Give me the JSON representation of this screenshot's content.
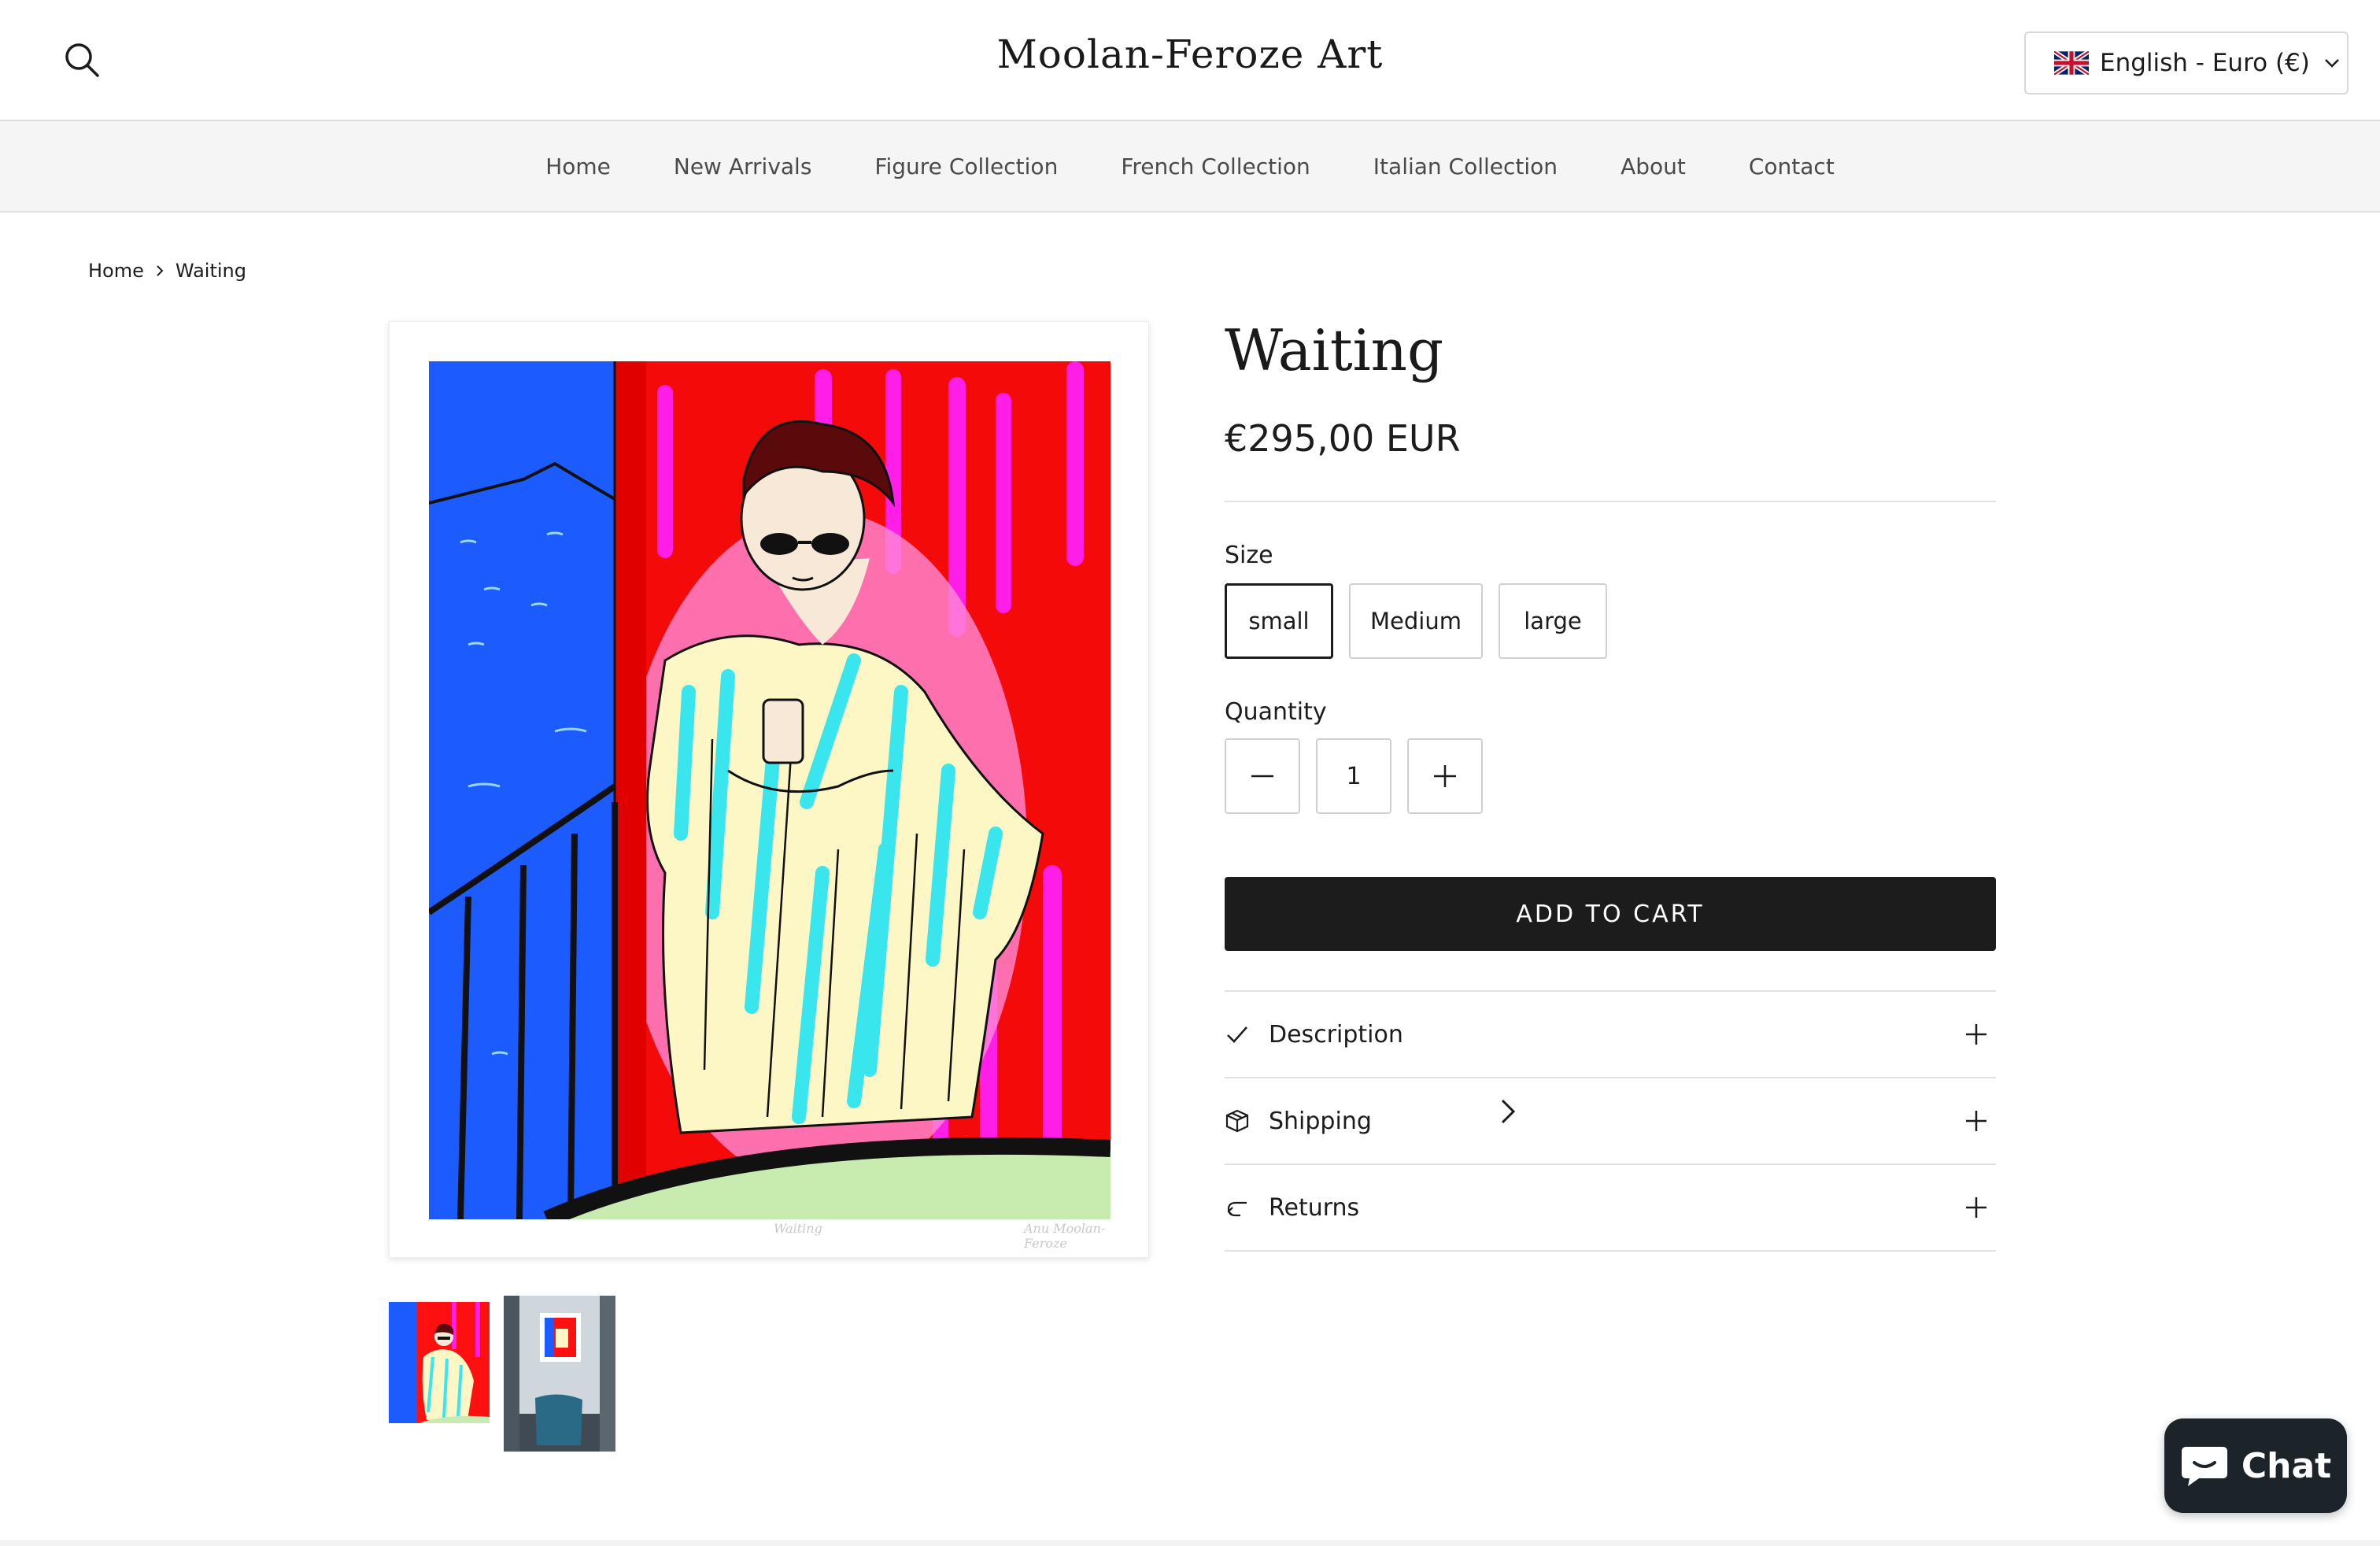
{
  "header": {
    "logo": "Moolan-Feroze Art",
    "locale_label": "English - Euro (€)",
    "icons": {
      "search": "search-icon",
      "flag": "uk-flag-icon",
      "dropdown": "chevron-down-icon"
    }
  },
  "nav": {
    "items": [
      {
        "label": "Home"
      },
      {
        "label": "New Arrivals"
      },
      {
        "label": "Figure Collection"
      },
      {
        "label": "French Collection"
      },
      {
        "label": "Italian Collection"
      },
      {
        "label": "About"
      },
      {
        "label": "Contact"
      }
    ]
  },
  "breadcrumb": {
    "home": "Home",
    "current": "Waiting"
  },
  "gallery": {
    "main_alt": "Waiting artwork: woman in striped shirt with sunglasses looking at phone on balcony",
    "signature_left": "Waiting",
    "signature_right": "Anu Moolan-Feroze",
    "thumbnail_count": 2
  },
  "product": {
    "title": "Waiting",
    "price": "€295,00 EUR",
    "size_label": "Size",
    "sizes": [
      "small",
      "Medium",
      "large"
    ],
    "selected_size": "small",
    "quantity_label": "Quantity",
    "quantity": "1",
    "add_to_cart": "ADD TO CART",
    "accordion": [
      {
        "label": "Description",
        "icon": "check-icon"
      },
      {
        "label": "Shipping",
        "icon": "box-icon"
      },
      {
        "label": "Returns",
        "icon": "return-arrow-icon"
      }
    ]
  },
  "chat": {
    "label": "Chat",
    "icon": "chat-bubble-icon"
  },
  "colors": {
    "primary_button": "#1c1c1c",
    "nav_bg": "#f5f5f5",
    "chat_bg": "#1c2329"
  }
}
